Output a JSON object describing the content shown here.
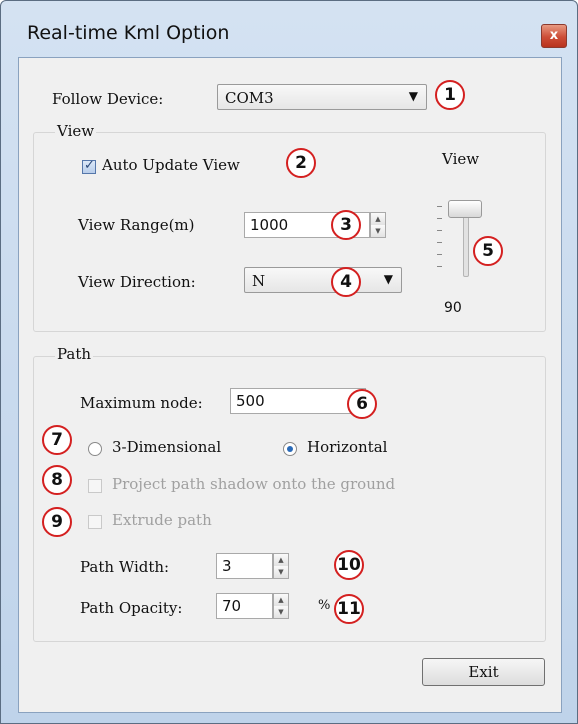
{
  "window": {
    "title": "Real-time Kml Option",
    "close_glyph": "x"
  },
  "follow_device": {
    "label": "Follow Device:",
    "value": "COM3",
    "arrow": "▼"
  },
  "view_group": {
    "title": "View",
    "auto_update": {
      "label": "Auto Update View",
      "checked": true
    },
    "range": {
      "label": "View Range(m)",
      "value": "1000"
    },
    "direction": {
      "label": "View Direction:",
      "value": "N",
      "arrow": "▼"
    },
    "slider": {
      "label": "View",
      "value": "90"
    }
  },
  "path_group": {
    "title": "Path",
    "max_node": {
      "label": "Maximum node:",
      "value": "500"
    },
    "mode": {
      "option_3d": "3-Dimensional",
      "option_horizontal": "Horizontal",
      "selected": "Horizontal"
    },
    "project_shadow": {
      "label": "Project path shadow onto the ground",
      "enabled": false
    },
    "extrude": {
      "label": "Extrude path",
      "enabled": false
    },
    "width": {
      "label": "Path Width:",
      "value": "3"
    },
    "opacity": {
      "label": "Path Opacity:",
      "value": "70",
      "unit": "%"
    }
  },
  "exit_button": {
    "label": "Exit"
  },
  "spinner_glyphs": {
    "up": "▲",
    "down": "▼"
  },
  "annotations": [
    "1",
    "2",
    "3",
    "4",
    "5",
    "6",
    "7",
    "8",
    "9",
    "10",
    "11"
  ],
  "colors": {
    "annotation_ring": "#d42020",
    "title_bar": "#c9daee",
    "client": "#f0f0f0"
  }
}
